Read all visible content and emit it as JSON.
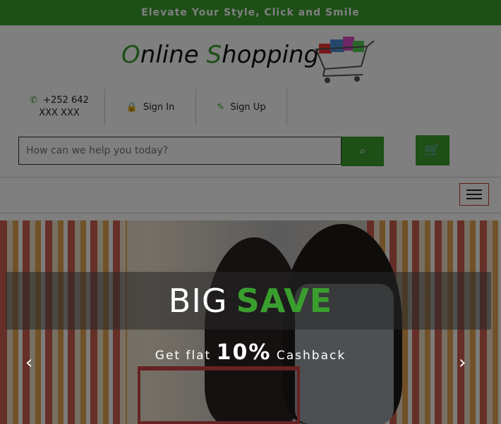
{
  "topbar": {
    "tagline": "Elevate Your Style, Click and Smile"
  },
  "logo": {
    "o": "O",
    "nline": "nline ",
    "s": "S",
    "hopping": "hopping"
  },
  "contact": {
    "phone": "+252 642 XXX XXX"
  },
  "auth": {
    "signin": "Sign In",
    "signup": "Sign Up"
  },
  "search": {
    "placeholder": "How can we help you today?"
  },
  "hero": {
    "big": "BIG",
    "save": "SAVE",
    "cashback_pre": "Get flat ",
    "cashback_pct": "10%",
    "cashback_post": " Cashback",
    "prev": "‹",
    "next": "›"
  },
  "icons": {
    "phone": "phone-icon",
    "lock": "lock-icon",
    "edit": "edit-icon",
    "search": "search-icon",
    "cart": "cart-icon",
    "menu": "hamburger-icon"
  },
  "colors": {
    "brand_green": "#3a9e2f",
    "overlay": "rgba(0,0,0,0.5)"
  }
}
